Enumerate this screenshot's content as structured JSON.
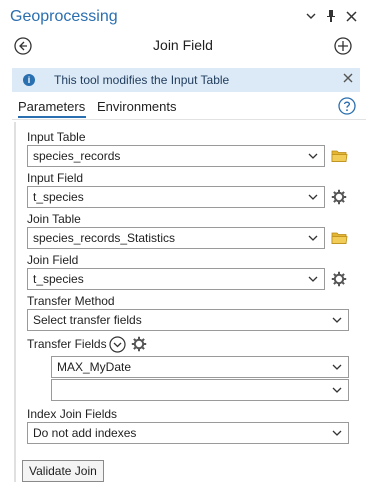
{
  "app": {
    "title": "Geoprocessing"
  },
  "tool": {
    "title": "Join Field"
  },
  "banner": {
    "text": "This tool modifies the Input Table"
  },
  "tabs": [
    {
      "label": "Parameters"
    },
    {
      "label": "Environments"
    }
  ],
  "params": {
    "input_table": {
      "label": "Input Table",
      "value": "species_records"
    },
    "input_field": {
      "label": "Input Field",
      "value": "t_species"
    },
    "join_table": {
      "label": "Join Table",
      "value": "species_records_Statistics"
    },
    "join_field": {
      "label": "Join Field",
      "value": "t_species"
    },
    "transfer_method": {
      "label": "Transfer Method",
      "value": "Select transfer fields"
    },
    "transfer_fields": {
      "label": "Transfer Fields",
      "items": [
        "MAX_MyDate",
        ""
      ]
    },
    "index_join_fields": {
      "label": "Index Join Fields",
      "value": "Do not add indexes"
    }
  },
  "buttons": {
    "validate": "Validate Join"
  },
  "colors": {
    "accent": "#2a6fb0",
    "banner_bg": "#dbeaf6",
    "folder": "#e3b534"
  }
}
